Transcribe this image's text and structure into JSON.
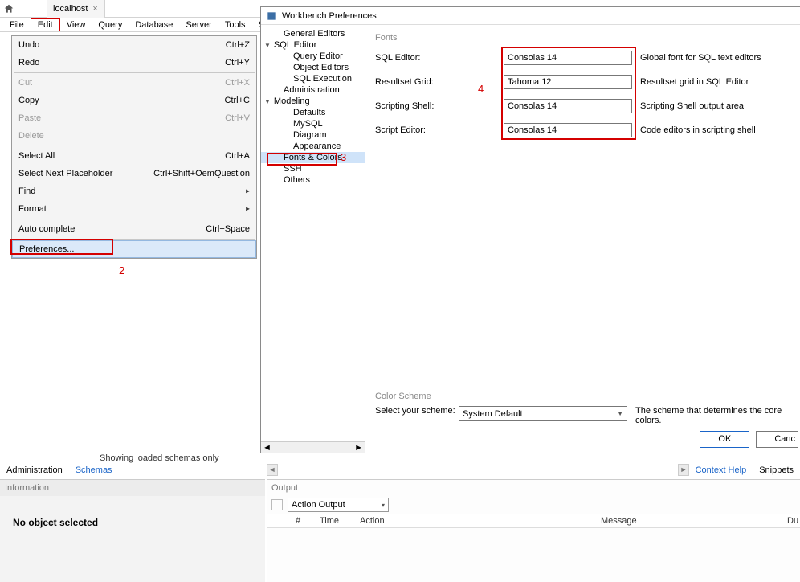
{
  "toolbar": {
    "tab_label": "localhost",
    "tab_close": "×"
  },
  "menubar": [
    "File",
    "Edit",
    "View",
    "Query",
    "Database",
    "Server",
    "Tools",
    "S"
  ],
  "edit_menu": {
    "items": [
      {
        "label": "Undo",
        "shortcut": "Ctrl+Z",
        "type": "row"
      },
      {
        "label": "Redo",
        "shortcut": "Ctrl+Y",
        "type": "row"
      },
      {
        "type": "sep"
      },
      {
        "label": "Cut",
        "shortcut": "Ctrl+X",
        "type": "row",
        "disabled": true
      },
      {
        "label": "Copy",
        "shortcut": "Ctrl+C",
        "type": "row"
      },
      {
        "label": "Paste",
        "shortcut": "Ctrl+V",
        "type": "row",
        "disabled": true
      },
      {
        "label": "Delete",
        "shortcut": "",
        "type": "row",
        "disabled": true
      },
      {
        "type": "sep"
      },
      {
        "label": "Select All",
        "shortcut": "Ctrl+A",
        "type": "row"
      },
      {
        "label": "Select Next Placeholder",
        "shortcut": "Ctrl+Shift+OemQuestion",
        "type": "row"
      },
      {
        "label": "Find",
        "shortcut": "",
        "type": "arrow"
      },
      {
        "label": "Format",
        "shortcut": "",
        "type": "arrow"
      },
      {
        "type": "sep"
      },
      {
        "label": "Auto complete",
        "shortcut": "Ctrl+Space",
        "type": "row"
      },
      {
        "type": "sep"
      },
      {
        "label": "Preferences...",
        "shortcut": "",
        "type": "row",
        "hl": true
      }
    ]
  },
  "dialog": {
    "title": "Workbench Preferences",
    "tree": [
      {
        "label": "General Editors",
        "depth": 1
      },
      {
        "label": "SQL Editor",
        "depth": 0,
        "exp": true
      },
      {
        "label": "Query Editor",
        "depth": 2
      },
      {
        "label": "Object Editors",
        "depth": 2
      },
      {
        "label": "SQL Execution",
        "depth": 2
      },
      {
        "label": "Administration",
        "depth": 1
      },
      {
        "label": "Modeling",
        "depth": 0,
        "exp": true
      },
      {
        "label": "Defaults",
        "depth": 2
      },
      {
        "label": "MySQL",
        "depth": 2
      },
      {
        "label": "Diagram",
        "depth": 2
      },
      {
        "label": "Appearance",
        "depth": 2
      },
      {
        "label": "Fonts & Colors",
        "depth": 1,
        "sel": true
      },
      {
        "label": "SSH",
        "depth": 1
      },
      {
        "label": "Others",
        "depth": 1
      }
    ],
    "fonts_label": "Fonts",
    "font_rows": [
      {
        "label": "SQL Editor:",
        "value": "Consolas 14",
        "desc": "Global font for SQL text editors"
      },
      {
        "label": "Resultset Grid:",
        "value": "Tahoma 12",
        "desc": "Resultset grid in SQL Editor"
      },
      {
        "label": "Scripting Shell:",
        "value": "Consolas 14",
        "desc": "Scripting Shell output area"
      },
      {
        "label": "Script Editor:",
        "value": "Consolas 14",
        "desc": "Code editors in scripting shell"
      }
    ],
    "color_scheme": {
      "label": "Color Scheme",
      "prompt": "Select your scheme:",
      "value": "System Default",
      "desc": "The scheme that determines the core colors."
    },
    "buttons": {
      "ok": "OK",
      "cancel": "Canc"
    }
  },
  "annotations": {
    "a2": "2",
    "a3": "3",
    "a4": "4"
  },
  "schema_note": "Showing loaded schemas only",
  "schema_tabs": {
    "admin": "Administration",
    "schemas": "Schemas"
  },
  "right_tabs": {
    "help": "Context Help",
    "snippets": "Snippets"
  },
  "info": {
    "title": "Information",
    "body": "No object selected"
  },
  "output": {
    "title": "Output",
    "select": "Action Output",
    "cols": [
      "#",
      "Time",
      "Action",
      "Message",
      "Du"
    ]
  }
}
